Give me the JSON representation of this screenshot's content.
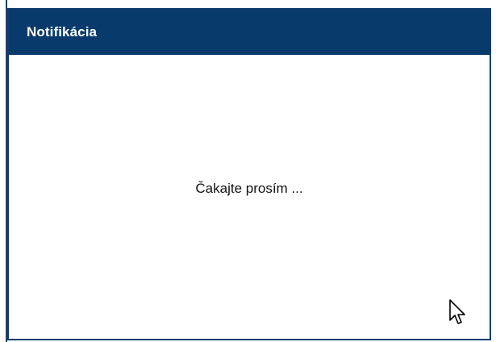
{
  "dialog": {
    "title": "Notifikácia",
    "message": "Čakajte prosím ..."
  },
  "colors": {
    "title_bar": "#083a6b",
    "title_text": "#ffffff",
    "border": "#103c6e",
    "background": "#ffffff",
    "message_text": "#111111"
  },
  "icons": {
    "cursor": "mouse-pointer-icon"
  }
}
